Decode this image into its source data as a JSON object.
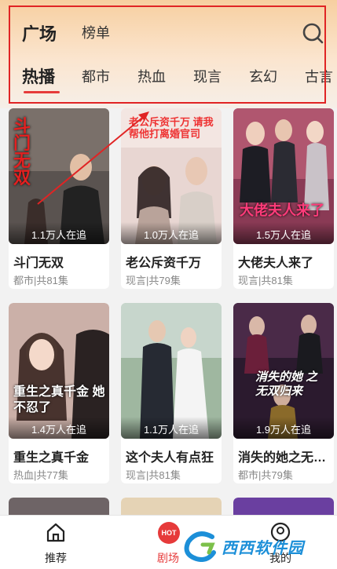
{
  "top_tabs": [
    "广场",
    "榜单"
  ],
  "categories": [
    "热播",
    "都市",
    "热血",
    "现言",
    "玄幻",
    "古言"
  ],
  "cards": [
    {
      "title": "斗门无双",
      "meta": "都市|共81集",
      "viewers": "1.1万人在追",
      "poster_text": "斗门无双"
    },
    {
      "title": "老公斥资千万",
      "meta": "现言|共79集",
      "viewers": "1.0万人在追",
      "poster_text": "老公斥资千万 请我帮他打离婚官司"
    },
    {
      "title": "大佬夫人来了",
      "meta": "现言|共81集",
      "viewers": "1.5万人在追",
      "poster_text": "大佬夫人来了"
    },
    {
      "title": "重生之真千金",
      "meta": "热血|共77集",
      "viewers": "1.4万人在追",
      "poster_text": "重生之真千金 她不忍了"
    },
    {
      "title": "这个夫人有点狂",
      "meta": "现言|共81集",
      "viewers": "1.1万人在追",
      "poster_text": ""
    },
    {
      "title": "消失的她之无双归来",
      "meta": "都市|共79集",
      "viewers": "1.9万人在追",
      "poster_text": "消失的她 之无双归来"
    }
  ],
  "nav": [
    {
      "label": "推荐",
      "icon": "house-icon"
    },
    {
      "label": "剧场",
      "icon": "hot-badge-icon",
      "badge": "HOT"
    },
    {
      "label": "我的",
      "icon": "profile-icon"
    }
  ],
  "watermark": "西西软件园",
  "colors": {
    "accent": "#e63a3a",
    "highlight_box": "#e02424"
  }
}
